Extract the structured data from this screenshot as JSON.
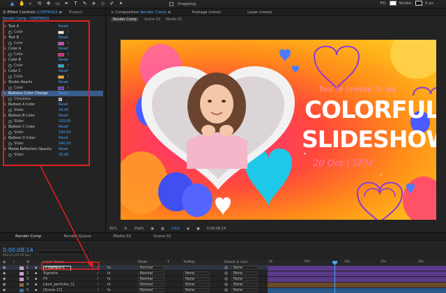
{
  "toolbar": {
    "fill_label": "Fill:",
    "stroke_label": "Stroke:",
    "stroke_value": "0 px",
    "snapping_label": "Snapping"
  },
  "left_panel": {
    "tab_effect_controls_prefix": "Effect Controls",
    "tab_effect_controls_layer": "CONTROLS",
    "tab_project": "Project",
    "breadcrumb": "Render Comp · CONTROLS",
    "reset_label": "Reset",
    "effects": [
      {
        "name": "Text A",
        "param": "Color",
        "kind": "color",
        "color": "#ffffff"
      },
      {
        "name": "Text B",
        "param": "Color",
        "kind": "color",
        "color": "#e040c8"
      },
      {
        "name": "Color A",
        "param": "Color",
        "kind": "color",
        "color": "#e02080"
      },
      {
        "name": "Color B",
        "param": "Color",
        "kind": "color",
        "color": "#20a8e0"
      },
      {
        "name": "Color C",
        "param": "Color",
        "kind": "color",
        "color": "#f0b020"
      },
      {
        "name": "Stroke Hearts",
        "param": "Color",
        "kind": "color",
        "color": "#6a30d0"
      },
      {
        "name": "Balloons Color Change",
        "param": "Checkbox",
        "kind": "check",
        "selected": true
      },
      {
        "name": "Balloon A Color",
        "param": "Slider",
        "kind": "value",
        "value": "34,00"
      },
      {
        "name": "Balloon B Color",
        "param": "Slider",
        "kind": "value",
        "value": "220,00"
      },
      {
        "name": "Balloon C Color",
        "param": "Slider",
        "kind": "value",
        "value": "190,00"
      },
      {
        "name": "Balloon D Color",
        "param": "Slider",
        "kind": "value",
        "value": "240,00"
      },
      {
        "name": "Media Reflection Opacity",
        "param": "Slider",
        "kind": "value",
        "value": "25,00"
      }
    ]
  },
  "comp_panel": {
    "tab_composition_prefix": "Composition",
    "tab_composition_name": "Render Comp",
    "tab_footage": "Footage (none)",
    "tab_layer": "Layer (none)",
    "subtabs": [
      "Render Comp",
      "Scene 02",
      "Media 01"
    ],
    "invite_text": "You're invited to my",
    "title_line1": "COLORFUL",
    "title_line2": "SLIDESHOW",
    "date_text": "20 Oct | 5PM",
    "footer": {
      "zoom": "50%",
      "resolution": "(Half)",
      "exposure": "+0,0",
      "timecode": "0:00:08:14"
    }
  },
  "timeline": {
    "tabs": [
      "Render Comp",
      "Render Queue",
      "Media 02",
      "Scene 02"
    ],
    "timecode": "0:00:08:14",
    "fps": "00214 (25.00 fps)",
    "search_placeholder": "",
    "headers": {
      "source_name": "Layer Name",
      "mode": "Mode",
      "t": "T",
      "trkmat": "TrkMat",
      "parent": "Parent & Link"
    },
    "ruler_ticks": [
      "0s",
      "05s",
      "10s",
      "15s",
      "20s"
    ],
    "layers": [
      {
        "num": "1",
        "name": "CONTROLS",
        "mode": "Normal",
        "trkmat": "",
        "parent": "None",
        "label_color": "#c8a0d0",
        "track_color": "#5a3a8a",
        "selected": true
      },
      {
        "num": "2",
        "name": "Vignette",
        "mode": "Normal",
        "trkmat": "None",
        "parent": "None",
        "label_color": "#c8a0d0",
        "track_color": "#5a3a8a"
      },
      {
        "num": "3",
        "name": "FX",
        "mode": "Normal",
        "trkmat": "None",
        "parent": "None",
        "label_color": "#c8a0d0",
        "track_color": "#5a3a8a"
      },
      {
        "num": "4",
        "name": "[dust_particles_1]",
        "mode": "Normal",
        "trkmat": "None",
        "parent": "None",
        "label_color": "#8a6a3a",
        "track_color": "#6a4a2a"
      },
      {
        "num": "5",
        "name": "[Scene 12]",
        "mode": "Normal",
        "trkmat": "None",
        "parent": "None",
        "label_color": "#3a6a9a",
        "track_color": "#2a5a8a"
      }
    ]
  }
}
